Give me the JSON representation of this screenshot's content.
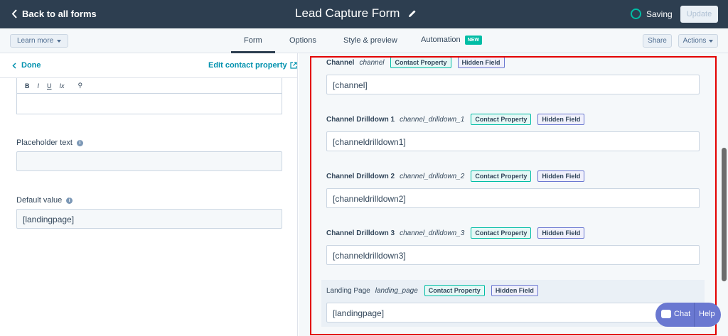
{
  "topbar": {
    "back_label": "Back to all forms",
    "title": "Lead Capture Form",
    "status": "Saving",
    "update_label": "Update"
  },
  "subnav": {
    "learn_more": "Learn more",
    "tabs": [
      {
        "label": "Form"
      },
      {
        "label": "Options"
      },
      {
        "label": "Style & preview"
      },
      {
        "label": "Automation",
        "badge": "NEW"
      }
    ],
    "share_label": "Share",
    "actions_label": "Actions"
  },
  "left_panel": {
    "done_label": "Done",
    "edit_property_label": "Edit contact property",
    "toolbar": [
      "B",
      "I",
      "U",
      "Ix",
      "⚲"
    ],
    "placeholder_label": "Placeholder text",
    "placeholder_value": "",
    "default_label": "Default value",
    "default_value": "[landingpage]"
  },
  "preview_fields": [
    {
      "name": "Channel",
      "internal": "channel",
      "tag1": "Contact Property",
      "tag2": "Hidden Field",
      "value": "[channel]"
    },
    {
      "name": "Channel Drilldown 1",
      "internal": "channel_drilldown_1",
      "tag1": "Contact Property",
      "tag2": "Hidden Field",
      "value": "[channeldrilldown1]"
    },
    {
      "name": "Channel Drilldown 2",
      "internal": "channel_drilldown_2",
      "tag1": "Contact Property",
      "tag2": "Hidden Field",
      "value": "[channeldrilldown2]"
    },
    {
      "name": "Channel Drilldown 3",
      "internal": "channel_drilldown_3",
      "tag1": "Contact Property",
      "tag2": "Hidden Field",
      "value": "[channeldrilldown3]"
    },
    {
      "name": "Landing Page",
      "internal": "landing_page",
      "tag1": "Contact Property",
      "tag2": "Hidden Field",
      "value": "[landingpage]"
    }
  ],
  "chat": {
    "chat_label": "Chat",
    "help_label": "Help"
  },
  "colors": {
    "topbar": "#2d3e50",
    "accent": "#0091ae",
    "highlight": "#e30000",
    "teal": "#00bda5"
  }
}
